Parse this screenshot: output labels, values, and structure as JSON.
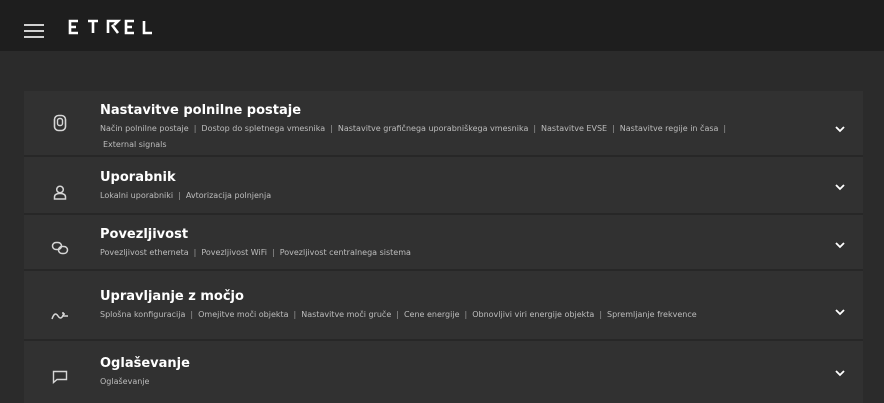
{
  "app": {
    "brand": "ETREL"
  },
  "sections": [
    {
      "title": "Nastavitve polnilne postaje",
      "items": [
        "Način polnilne postaje",
        "Dostop do spletnega vmesnika",
        "Nastavitve grafičnega uporabniškega vmesnika",
        "Nastavitve EVSE",
        "Nastavitve regije in časa",
        "External signals"
      ],
      "icon": "charger-icon"
    },
    {
      "title": "Uporabnik",
      "items": [
        "Lokalni uporabniki",
        "Avtorizacija polnjenja"
      ],
      "icon": "user-icon"
    },
    {
      "title": "Povezljivost",
      "items": [
        "Povezljivost etherneta",
        "Povezljivost WiFi",
        "Povezljivost centralnega sistema"
      ],
      "icon": "link-icon"
    },
    {
      "title": "Upravljanje z močjo",
      "items": [
        "Splošna konfiguracija",
        "Omejitve moči objekta",
        "Nastavitve moči gruče",
        "Cene energije",
        "Obnovljivi viri energije objekta",
        "Spremljanje frekvence"
      ],
      "icon": "power-wave-icon"
    },
    {
      "title": "Oglaševanje",
      "items": [
        "Oglaševanje"
      ],
      "icon": "message-icon"
    }
  ]
}
